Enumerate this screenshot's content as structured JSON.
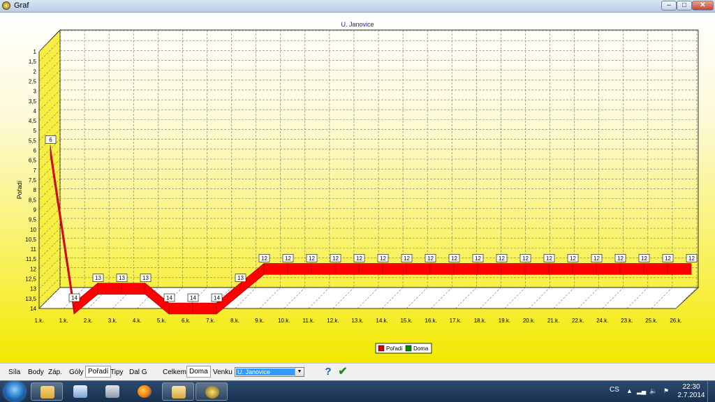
{
  "window": {
    "title": "Graf"
  },
  "chart_data": {
    "type": "line",
    "title": "U. Janovice",
    "ylabel": "Pořadí",
    "xlabel": "",
    "y_inverted": true,
    "ylim": [
      1,
      14
    ],
    "y_ticks": [
      "1",
      "1,5",
      "2",
      "2,5",
      "3",
      "3,5",
      "4",
      "4,5",
      "5",
      "5,5",
      "6",
      "6,5",
      "7",
      "7,5",
      "8",
      "8,5",
      "9",
      "9,5",
      "10",
      "10,5",
      "11",
      "11,5",
      "12",
      "12,5",
      "13",
      "13,5",
      "14"
    ],
    "x_tick_labels": [
      "1.k.",
      "1.k.",
      "2.k.",
      "3.k.",
      "4.k.",
      "5.k.",
      "6.k.",
      "7.k.",
      "8.k.",
      "9.k.",
      "10.k.",
      "11.k.",
      "12.k.",
      "13.k.",
      "14.k.",
      "15.k.",
      "16.k.",
      "17.k.",
      "18.k.",
      "19.k.",
      "20.k.",
      "21.k.",
      "22.k.",
      "24.k.",
      "23.k.",
      "25.k.",
      "26.k."
    ],
    "series": [
      {
        "name": "Pořadí",
        "color": "#ff0000",
        "values": [
          6,
          14,
          13,
          13,
          13,
          14,
          14,
          14,
          13,
          12,
          12,
          12,
          12,
          12,
          12,
          12,
          12,
          12,
          12,
          12,
          12,
          12,
          12,
          12,
          12,
          12,
          12,
          12
        ]
      },
      {
        "name": "Doma",
        "color": "#00aa00",
        "values": []
      }
    ],
    "legend_position": "bottom-center",
    "grid": true,
    "background": "#f2e800"
  },
  "toolbar": {
    "items": [
      "Síla",
      "Body",
      "Záp.",
      "Góly",
      "Pořadí",
      "Tipy",
      "Dal G"
    ],
    "active_item": "Pořadí",
    "view_items": [
      "Celkem",
      "Doma",
      "Venku"
    ],
    "active_view": "Doma",
    "team_selected": "U. Janovice"
  },
  "taskbar": {
    "language": "CS",
    "time": "22:30",
    "date": "2.7.2014"
  }
}
